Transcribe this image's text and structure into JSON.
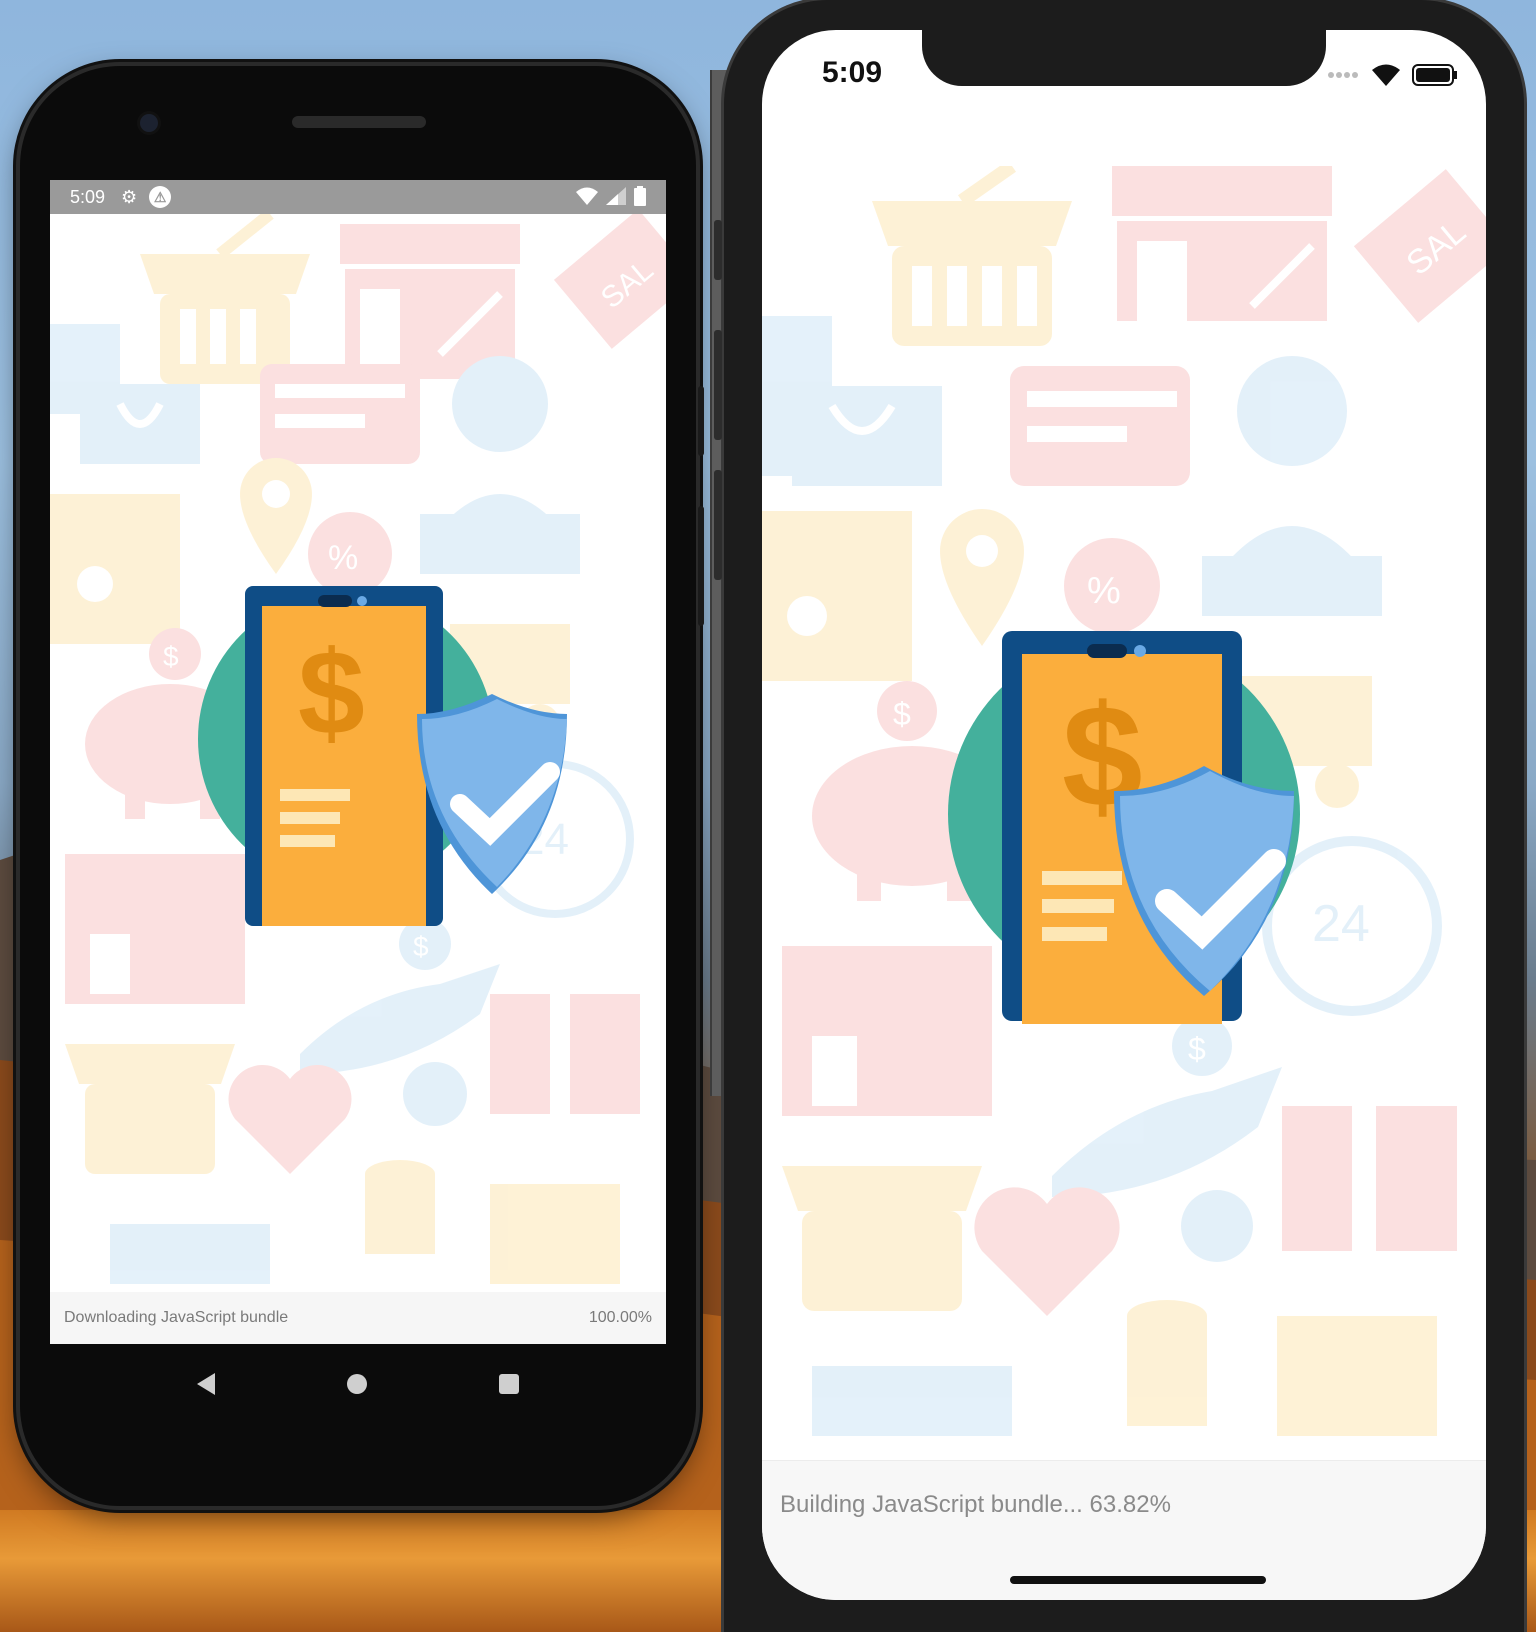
{
  "android": {
    "status_time": "5:09",
    "status_icons": [
      "gear-icon",
      "warning-icon",
      "wifi-icon",
      "signal-icon",
      "battery-icon"
    ],
    "bundle_label": "Downloading JavaScript bundle",
    "bundle_percent": "100.00%",
    "watermark_sale": "SAL",
    "clock_text": "24"
  },
  "ios": {
    "status_time": "5:09",
    "status_icons": [
      "cellular-dots-icon",
      "wifi-icon",
      "battery-icon"
    ],
    "bundle_message": "Building JavaScript bundle... 63.82%",
    "watermark_sale": "SAL",
    "clock_text": "24"
  },
  "colors": {
    "teal": "#44b09c",
    "phone_orange": "#fbae3d",
    "shield_blue": "#6aa9e4",
    "navy": "#0f4d86",
    "pattern_pink": "#f8d3d3",
    "pattern_blue": "#d5e9f5",
    "pattern_yellow": "#fdf0d2"
  }
}
